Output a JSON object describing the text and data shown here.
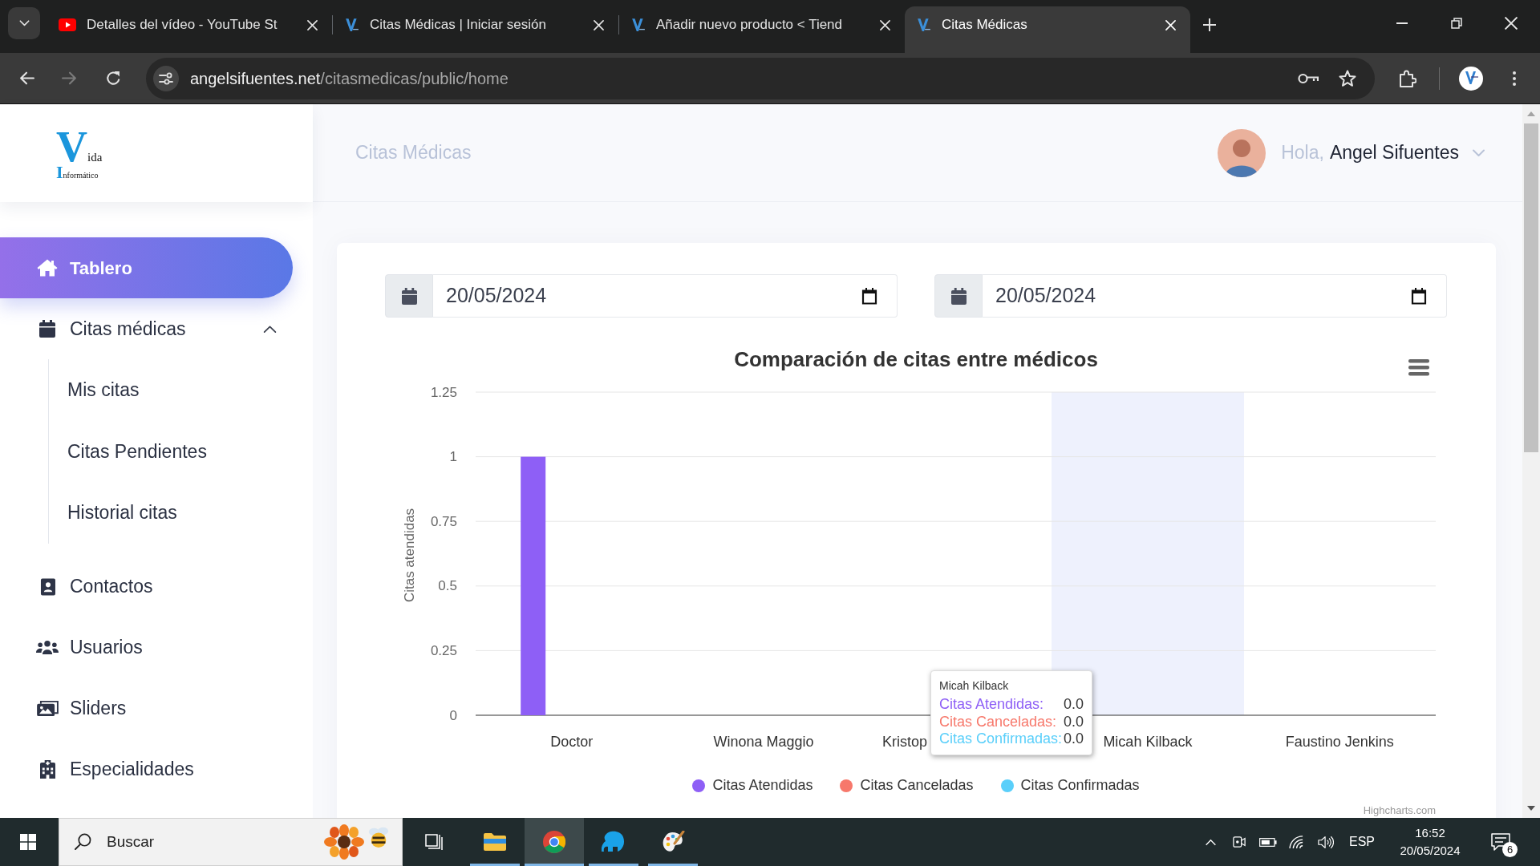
{
  "browser": {
    "tabs": [
      {
        "title": "Detalles del vídeo - YouTube St",
        "selected": false
      },
      {
        "title": "Citas Médicas | Iniciar sesión",
        "selected": false
      },
      {
        "title": "Añadir nuevo producto < Tiend",
        "selected": false
      },
      {
        "title": "Citas Médicas",
        "selected": true
      }
    ],
    "address_bar": {
      "host": "angelsifuentes.net",
      "path": "/citasmedicas/public/home"
    }
  },
  "sidebar": {
    "logo": {
      "title": "Vida",
      "subtitle": "Informático"
    },
    "items": [
      {
        "label": "Tablero",
        "selected": true
      },
      {
        "label": "Citas médicas",
        "selected": false,
        "expanded": true,
        "children": [
          {
            "label": "Mis citas",
            "selected": false
          },
          {
            "label": "Citas Pendientes",
            "selected": false
          },
          {
            "label": "Historial citas",
            "selected": false
          }
        ]
      },
      {
        "label": "Contactos",
        "selected": false
      },
      {
        "label": "Usuarios",
        "selected": false
      },
      {
        "label": "Sliders",
        "selected": false
      },
      {
        "label": "Especialidades",
        "selected": false
      }
    ]
  },
  "header": {
    "title": "Citas Médicas",
    "greeting": "Hola,",
    "user_name": "Angel Sifuentes"
  },
  "filters": [
    {
      "value": "20/05/2024"
    },
    {
      "value": "20/05/2024"
    }
  ],
  "chart": {
    "chart_data": {
      "type": "bar",
      "title": "Comparación de citas entre médicos",
      "ylabel": "Citas atendidas",
      "categories": [
        "Doctor",
        "Winona Maggio",
        "Kristop",
        "Micah Kilback",
        "Faustino Jenkins"
      ],
      "series": [
        {
          "name": "Citas Atendidas",
          "color": "#8e5ff6",
          "values": [
            1,
            0,
            0,
            0,
            0
          ]
        },
        {
          "name": "Citas Canceladas",
          "color": "#f7786b",
          "values": [
            0,
            0,
            0,
            0,
            0
          ]
        },
        {
          "name": "Citas Confirmadas",
          "color": "#5acffa",
          "values": [
            0,
            0,
            0,
            0,
            0
          ]
        }
      ],
      "ylim": [
        0,
        1.25
      ],
      "yticks": [
        0,
        0.25,
        0.5,
        0.75,
        1,
        1.25
      ],
      "grid": true
    },
    "tooltip": {
      "title": "Micah Kilback",
      "rows": [
        {
          "label": "Citas Atendidas:",
          "value": "0.0"
        },
        {
          "label": "Citas Canceladas:",
          "value": "0.0"
        },
        {
          "label": "Citas Confirmadas:",
          "value": "0.0"
        }
      ]
    },
    "credit": "Highcharts.com"
  },
  "taskbar": {
    "search_placeholder": "Buscar",
    "apps": [
      {
        "running": true,
        "selected": false
      },
      {
        "running": true,
        "selected": true
      },
      {
        "running": true,
        "selected": false
      },
      {
        "running": true,
        "selected": false
      }
    ],
    "language": "ESP",
    "time": "16:52",
    "date": "20/05/2024",
    "notification_count": "6"
  }
}
